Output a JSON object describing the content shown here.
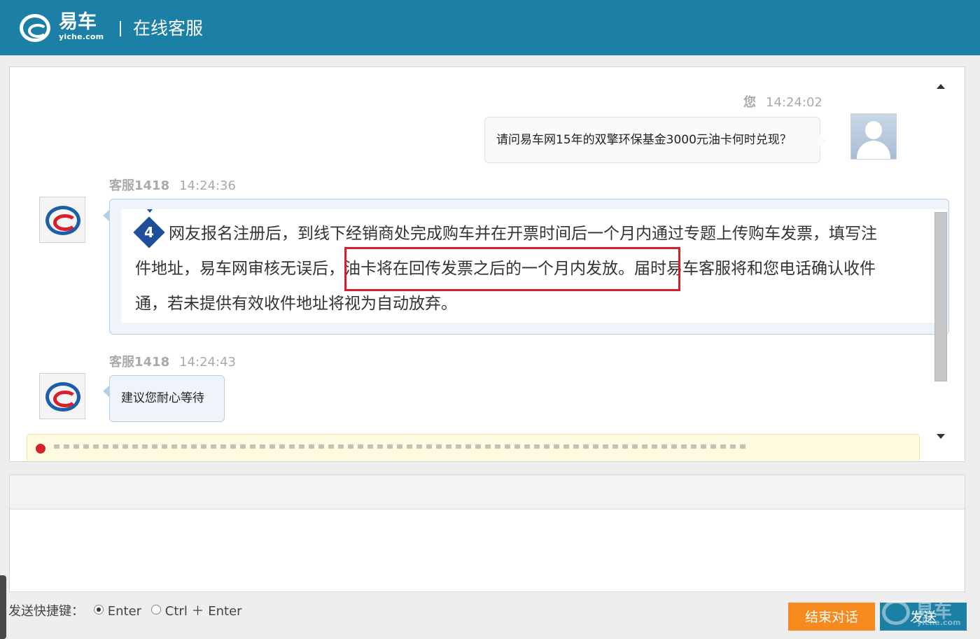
{
  "header": {
    "logo_text": "易车",
    "logo_sub": "yiche.com",
    "title": "在线客服"
  },
  "messages": [
    {
      "sender": "您",
      "time": "14:24:02",
      "text": "请问易车网15年的双擎环保基金3000元油卡何时兑现？"
    },
    {
      "sender": "客服1418",
      "time": "14:24:36",
      "badge": "4",
      "lines": [
        "网友报名注册后，到线下经销商处完成购车并在开票时间后一个月内通过专题上传购车发票，填写注",
        "件地址，易车网审核无误后，油卡将在回传发票之后的一个月内发放。届时易车客服将和您电话确认收件",
        "通，若未提供有效收件地址将视为自动放弃。"
      ]
    },
    {
      "sender": "客服1418",
      "time": "14:24:43",
      "text": "建议您耐心等待"
    }
  ],
  "footer": {
    "shortcut_label": "发送快捷键：",
    "option_enter": "Enter",
    "option_ctrl_enter": "Ctrl ＋ Enter",
    "selected": "Enter",
    "end_button": "结束对话",
    "send_button": "发送"
  },
  "watermark": {
    "text": "易车",
    "sub": "yiche.com"
  },
  "colors": {
    "header": "#1b7fa6",
    "end_button": "#f78a1d",
    "highlight": "#d6212b",
    "badge": "#1d4f9a"
  }
}
